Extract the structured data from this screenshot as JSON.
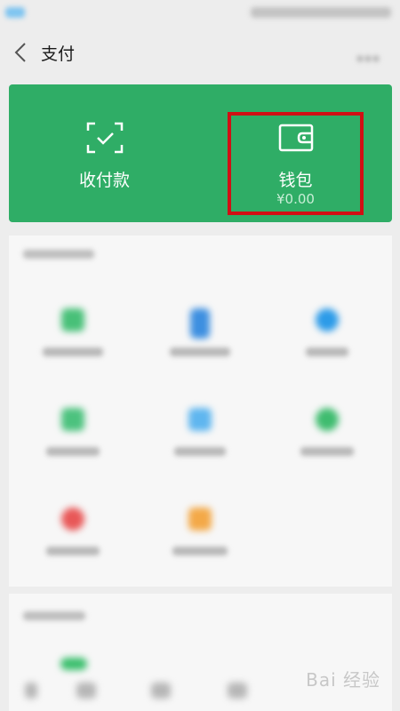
{
  "nav": {
    "title": "支付"
  },
  "hero": {
    "collect_label": "收付款",
    "wallet_label": "钱包",
    "wallet_balance": "¥0.00"
  },
  "watermark": {
    "text": "Bai 经验"
  },
  "colors": {
    "primary_green": "#2fad66",
    "highlight_red": "#d10f14"
  },
  "icons": {
    "collect": "scan-check-icon",
    "wallet": "wallet-icon",
    "back": "chevron-left-icon"
  }
}
